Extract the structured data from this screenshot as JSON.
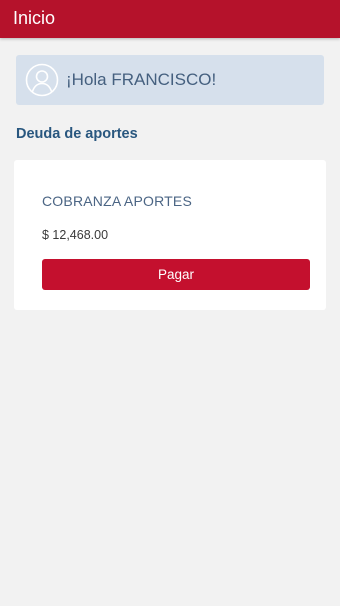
{
  "app_bar": {
    "title": "Inicio",
    "color": "#b5122b"
  },
  "greeting": {
    "avatar_icon": "user-circle-icon",
    "text": "¡Hola FRANCISCO!"
  },
  "section": {
    "title": "Deuda de aportes"
  },
  "debt_card": {
    "title": "COBRANZA APORTES",
    "amount": "$ 12,468.00",
    "pay_label": "Pagar",
    "button_color": "#c4102e"
  }
}
